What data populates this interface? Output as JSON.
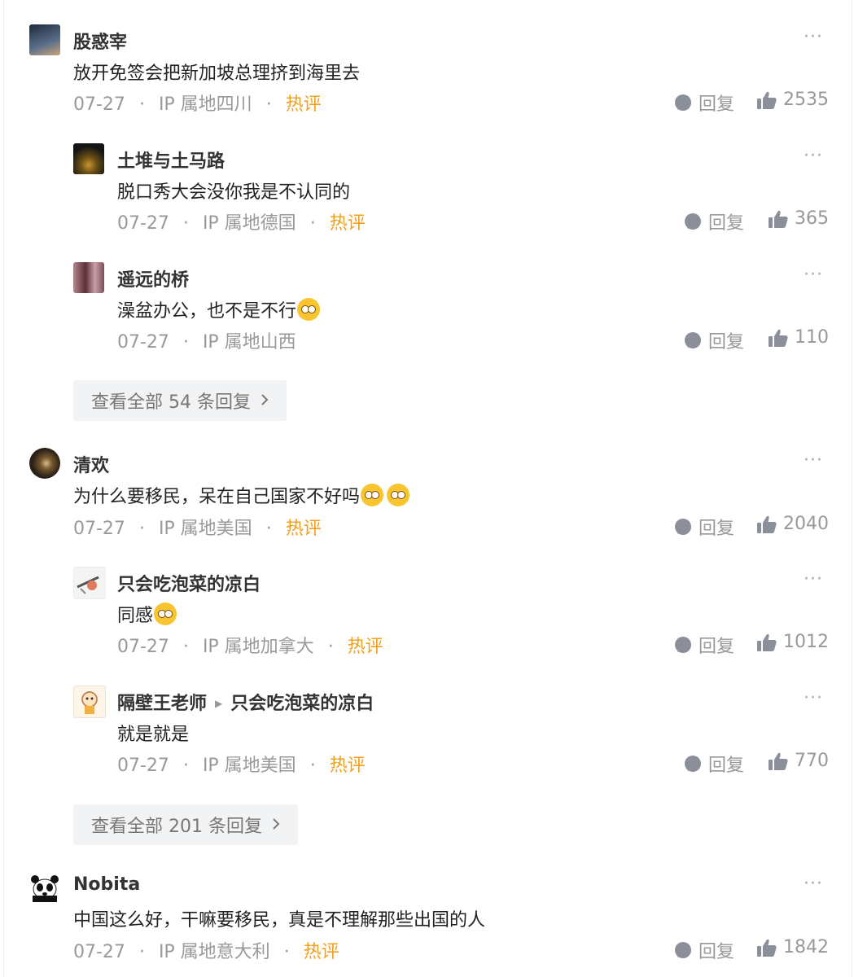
{
  "comments": [
    {
      "user": "股惑宰",
      "text": "放开免签会把新加坡总理挤到海里去",
      "date": "07-27",
      "ip": "IP 属地四川",
      "hot": "热评",
      "reply_label": "回复",
      "likes": "2535"
    },
    {
      "user": "土堆与土马路",
      "text": "脱口秀大会没你我是不认同的",
      "date": "07-27",
      "ip": "IP 属地德国",
      "hot": "热评",
      "reply_label": "回复",
      "likes": "365"
    },
    {
      "user": "遥远的桥",
      "text": "澡盆办公，也不是不行",
      "date": "07-27",
      "ip": "IP 属地山西",
      "reply_label": "回复",
      "likes": "110"
    },
    {
      "user": "清欢",
      "text": "为什么要移民，呆在自己国家不好吗",
      "date": "07-27",
      "ip": "IP 属地美国",
      "hot": "热评",
      "reply_label": "回复",
      "likes": "2040"
    },
    {
      "user": "只会吃泡菜的凉白",
      "text": "同感",
      "date": "07-27",
      "ip": "IP 属地加拿大",
      "hot": "热评",
      "reply_label": "回复",
      "likes": "1012"
    },
    {
      "user": "隔壁王老师",
      "reply_to": "只会吃泡菜的凉白",
      "text": "就是就是",
      "date": "07-27",
      "ip": "IP 属地美国",
      "hot": "热评",
      "reply_label": "回复",
      "likes": "770"
    },
    {
      "user": "Nobita",
      "text": "中国这么好，干嘛要移民，真是不理解那些出国的人",
      "date": "07-27",
      "ip": "IP 属地意大利",
      "hot": "热评",
      "reply_label": "回复",
      "likes": "1842"
    }
  ],
  "view_all": [
    "查看全部 54 条回复",
    "查看全部 201 条回复"
  ],
  "more_glyph": "···",
  "colors": {
    "hot": "#f0a020",
    "meta": "#999999",
    "more_bg": "#f2f3f5"
  }
}
